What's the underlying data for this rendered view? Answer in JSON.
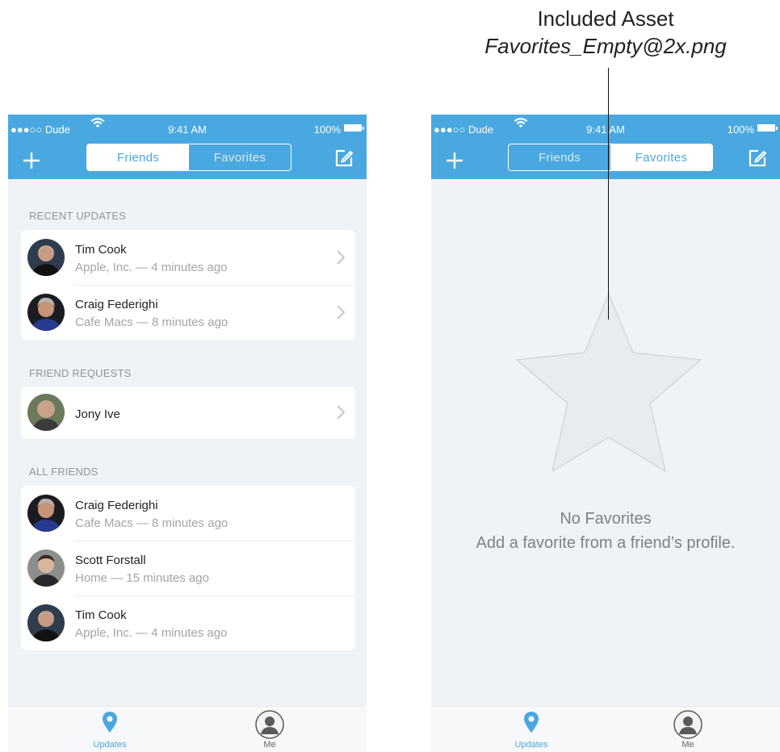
{
  "annotation": {
    "title": "Included Asset",
    "asset_name": "Favorites_Empty@2x.png"
  },
  "colors": {
    "accent": "#4aa8e0",
    "background": "#eff3f6",
    "text_secondary": "#9fa5aa"
  },
  "left_screen": {
    "status": {
      "carrier": "●●●○○ Dude",
      "time": "9:41 AM",
      "battery": "100%"
    },
    "segments": {
      "friends": "Friends",
      "favorites": "Favorites",
      "active": "friends"
    },
    "sections": {
      "recent": {
        "header": "RECENT UPDATES",
        "rows": [
          {
            "name": "Tim Cook",
            "subtitle": "Apple, Inc. — 4 minutes ago"
          },
          {
            "name": "Craig Federighi",
            "subtitle": "Cafe Macs — 8 minutes ago"
          }
        ]
      },
      "requests": {
        "header": "FRIEND REQUESTS",
        "rows": [
          {
            "name": "Jony Ive"
          }
        ]
      },
      "all": {
        "header": "ALL FRIENDS",
        "rows": [
          {
            "name": "Craig Federighi",
            "subtitle": "Cafe Macs — 8 minutes ago"
          },
          {
            "name": "Scott Forstall",
            "subtitle": "Home — 15 minutes ago"
          },
          {
            "name": "Tim Cook",
            "subtitle": "Apple, Inc. — 4 minutes ago"
          }
        ]
      }
    },
    "tabbar": {
      "updates": "Updates",
      "me": "Me"
    }
  },
  "right_screen": {
    "status": {
      "carrier": "●●●○○ Dude",
      "time": "9:41 AM",
      "battery": "100%"
    },
    "segments": {
      "friends": "Friends",
      "favorites": "Favorites",
      "active": "favorites"
    },
    "empty_state": {
      "icon": "star-icon",
      "title": "No Favorites",
      "subtitle": "Add a favorite from a friend’s profile."
    },
    "tabbar": {
      "updates": "Updates",
      "me": "Me"
    }
  }
}
